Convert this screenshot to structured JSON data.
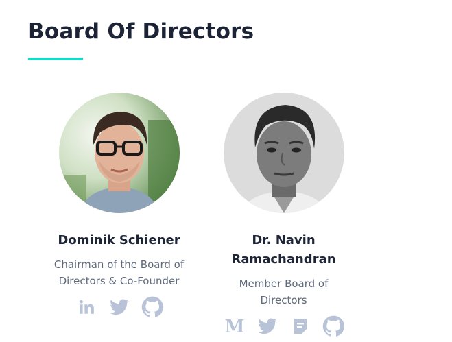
{
  "section": {
    "title": "Board Of Directors",
    "accent_color": "#1fd6c5",
    "icon_color": "#b9c3d8"
  },
  "members": [
    {
      "name": "Dominik Schiener",
      "role": "Chairman of the Board of Directors & Co-Founder",
      "social_icons": [
        "linkedin-icon",
        "twitter-icon",
        "github-icon"
      ]
    },
    {
      "name": "Dr. Navin Ramachandran",
      "role": "Member Board of Directors",
      "social_icons": [
        "medium-icon",
        "twitter-icon",
        "blog-icon",
        "github-icon"
      ]
    }
  ]
}
